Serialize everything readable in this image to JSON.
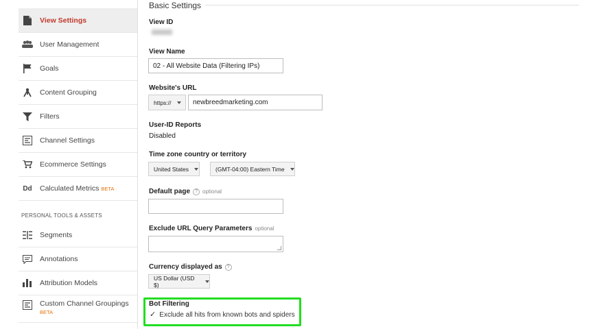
{
  "sidebar": {
    "items": [
      {
        "label": "View Settings",
        "icon": "document-icon"
      },
      {
        "label": "User Management",
        "icon": "users-icon"
      },
      {
        "label": "Goals",
        "icon": "flag-icon"
      },
      {
        "label": "Content Grouping",
        "icon": "content-grouping-icon"
      },
      {
        "label": "Filters",
        "icon": "filter-icon"
      },
      {
        "label": "Channel Settings",
        "icon": "channel-settings-icon"
      },
      {
        "label": "Ecommerce Settings",
        "icon": "cart-icon"
      },
      {
        "label": "Calculated Metrics",
        "icon": "calculated-metrics-icon",
        "badge": "BETA"
      }
    ],
    "section_title": "PERSONAL TOOLS & ASSETS",
    "tools": [
      {
        "label": "Segments",
        "icon": "segments-icon"
      },
      {
        "label": "Annotations",
        "icon": "annotation-icon"
      },
      {
        "label": "Attribution Models",
        "icon": "bar-chart-icon"
      },
      {
        "label": "Custom Channel Groupings",
        "icon": "channel-groupings-icon",
        "badge": "BETA"
      }
    ]
  },
  "main": {
    "section_title": "Basic Settings",
    "view_id_label": "View ID",
    "view_name_label": "View Name",
    "view_name_value": "02 - All Website Data (Filtering IPs)",
    "website_url_label": "Website's URL",
    "protocol": "https://",
    "website_url_value": "newbreedmarketing.com",
    "user_id_label": "User-ID Reports",
    "user_id_value": "Disabled",
    "timezone_label": "Time zone country or territory",
    "country": "United States",
    "timezone": "(GMT-04:00) Eastern Time",
    "default_page_label": "Default page",
    "optional": "optional",
    "exclude_label": "Exclude URL Query Parameters",
    "currency_label": "Currency displayed as",
    "currency": "US Dollar (USD $)",
    "bot_filtering_label": "Bot Filtering",
    "bot_filtering_checkbox": "Exclude all hits from known bots and spiders",
    "help": "?"
  },
  "colors": {
    "active": "#c0392b",
    "beta": "#e8710a",
    "highlight": "#22dd22"
  }
}
